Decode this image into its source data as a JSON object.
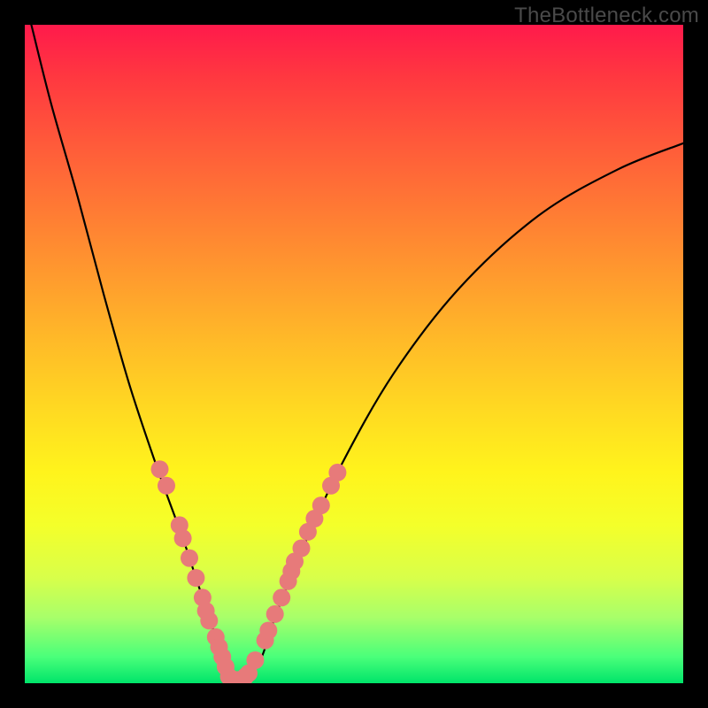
{
  "watermark": "TheBottleneck.com",
  "chart_data": {
    "type": "line",
    "title": "",
    "xlabel": "",
    "ylabel": "",
    "xlim": [
      0,
      100
    ],
    "ylim": [
      0,
      100
    ],
    "grid": false,
    "legend": false,
    "series": [
      {
        "name": "bottleneck-curve",
        "x": [
          1,
          4,
          8,
          12,
          16,
          20,
          24,
          26,
          28,
          30,
          31,
          32,
          33,
          34,
          36,
          38,
          42,
          48,
          56,
          66,
          78,
          90,
          100
        ],
        "values": [
          100,
          88,
          74,
          59,
          45,
          33,
          22,
          16,
          10,
          4,
          1,
          0,
          0,
          1,
          4,
          10,
          20,
          33,
          47,
          60,
          71,
          78,
          82
        ]
      }
    ],
    "markers": {
      "name": "sample-dots",
      "color": "#e77a7a",
      "radius_px": 10,
      "points": [
        {
          "x": 20.5,
          "y": 32.5
        },
        {
          "x": 21.5,
          "y": 30.0
        },
        {
          "x": 23.5,
          "y": 24.0
        },
        {
          "x": 24.0,
          "y": 22.0
        },
        {
          "x": 25.0,
          "y": 19.0
        },
        {
          "x": 26.0,
          "y": 16.0
        },
        {
          "x": 27.0,
          "y": 13.0
        },
        {
          "x": 27.5,
          "y": 11.0
        },
        {
          "x": 28.0,
          "y": 9.5
        },
        {
          "x": 29.0,
          "y": 7.0
        },
        {
          "x": 29.5,
          "y": 5.5
        },
        {
          "x": 30.0,
          "y": 4.0
        },
        {
          "x": 30.5,
          "y": 2.5
        },
        {
          "x": 31.0,
          "y": 1.0
        },
        {
          "x": 31.5,
          "y": 0.5
        },
        {
          "x": 32.0,
          "y": 0.5
        },
        {
          "x": 32.5,
          "y": 0.5
        },
        {
          "x": 33.0,
          "y": 0.5
        },
        {
          "x": 33.5,
          "y": 1.0
        },
        {
          "x": 34.0,
          "y": 1.5
        },
        {
          "x": 35.0,
          "y": 3.5
        },
        {
          "x": 36.5,
          "y": 6.5
        },
        {
          "x": 37.0,
          "y": 8.0
        },
        {
          "x": 38.0,
          "y": 10.5
        },
        {
          "x": 39.0,
          "y": 13.0
        },
        {
          "x": 40.0,
          "y": 15.5
        },
        {
          "x": 40.5,
          "y": 17.0
        },
        {
          "x": 41.0,
          "y": 18.5
        },
        {
          "x": 42.0,
          "y": 20.5
        },
        {
          "x": 43.0,
          "y": 23.0
        },
        {
          "x": 44.0,
          "y": 25.0
        },
        {
          "x": 45.0,
          "y": 27.0
        },
        {
          "x": 46.5,
          "y": 30.0
        },
        {
          "x": 47.5,
          "y": 32.0
        }
      ]
    }
  }
}
